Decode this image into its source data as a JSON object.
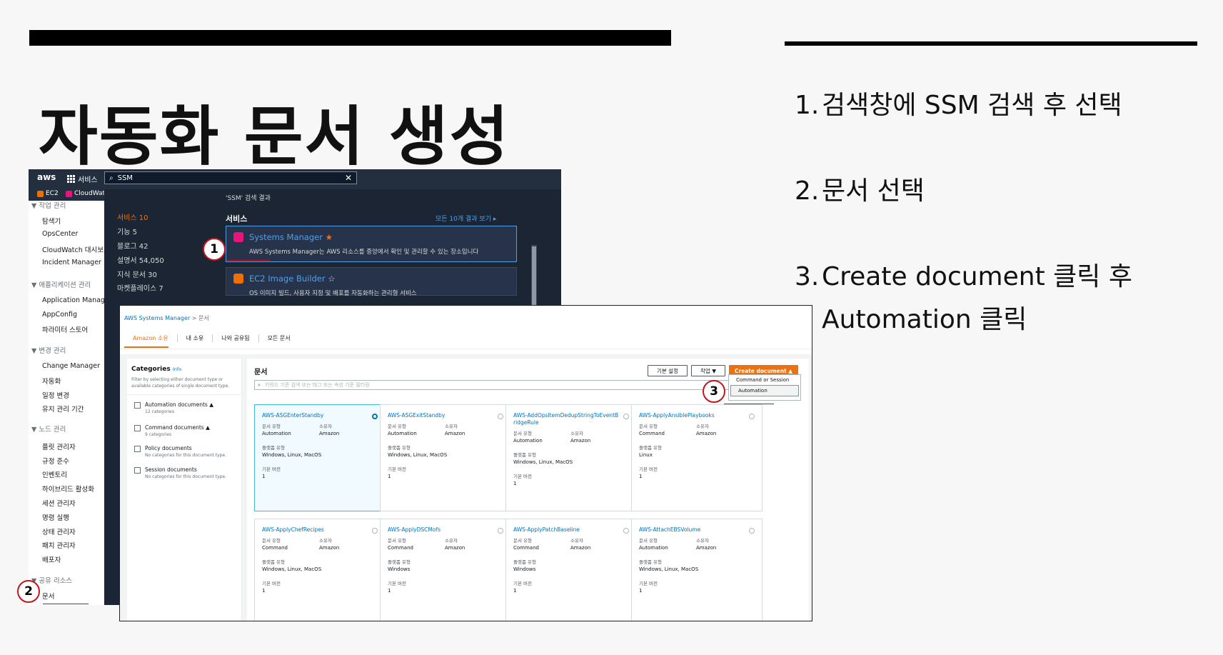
{
  "slide": {
    "title": "자동화 문서 생성",
    "steps": [
      {
        "num": "1.",
        "text": "검색창에 SSM 검색 후 선택"
      },
      {
        "num": "2.",
        "text": "문서 선택"
      },
      {
        "num": "3.",
        "text": "Create document 클릭 후 Automation 클릭"
      }
    ],
    "markers": [
      "1",
      "2",
      "3"
    ]
  },
  "console": {
    "logo": "aws",
    "services_label": "서비스",
    "search_value": "SSM",
    "favorites": [
      "EC2",
      "CloudWatch"
    ],
    "sidenav": {
      "sections": [
        {
          "title": "작업 관리",
          "items": [
            "탐색기",
            "OpsCenter",
            "CloudWatch 대시보드",
            "Incident Manager"
          ]
        },
        {
          "title": "애플리케이션 관리",
          "items": [
            "Application Manager",
            "AppConfig",
            "파라미터 스토어"
          ]
        },
        {
          "title": "변경 관리",
          "items": [
            "Change Manager",
            "자동화",
            "일정 변경",
            "유지 관리 기간"
          ]
        },
        {
          "title": "노드 관리",
          "items": [
            "플릿 관리자",
            "규정 준수",
            "인벤토리",
            "하이브리드 활성화",
            "세션 관리자",
            "명령 실행",
            "상태 관리자",
            "패치 관리자",
            "배포자"
          ]
        },
        {
          "title": "공유 리소스",
          "items": [
            "문서"
          ]
        }
      ]
    },
    "search_dropdown": {
      "categories": [
        "서비스 10",
        "기능 5",
        "블로그 42",
        "설명서 54,050",
        "지식 문서 30",
        "마켓플레이스 7"
      ],
      "results_title": "'SSM' 검색 결과",
      "section_title": "서비스",
      "see_all": "모든 10개 결과 보기",
      "results": [
        {
          "name": "Systems Manager",
          "desc": "AWS Systems Manager는 AWS 리소스를 중앙에서 확인 및 관리할 수 있는 장소입니다",
          "star": "★",
          "color": "#e7157b"
        },
        {
          "name": "EC2 Image Builder",
          "desc": "OS 이미지 빌드, 사용자 지정 및 배포를 자동화하는 관리형 서비스",
          "star": "☆",
          "color": "#ed7100"
        }
      ]
    }
  },
  "documents_page": {
    "breadcrumb": [
      "AWS Systems Manager",
      "문서"
    ],
    "tabs": [
      "Amazon 소유",
      "내 소유",
      "나와 공유됨",
      "모든 문서"
    ],
    "categories": {
      "title": "Categories",
      "info": "Info",
      "desc": "Filter by selecting either document type or available categories of single document type.",
      "items": [
        {
          "label": "Automation documents",
          "sub": "12 categories"
        },
        {
          "label": "Command documents",
          "sub": "9 categories"
        },
        {
          "label": "Policy documents",
          "sub": "No categories for this document type."
        },
        {
          "label": "Session documents",
          "sub": "No categories for this document type."
        }
      ]
    },
    "main_title": "문서",
    "buttons": {
      "default_settings": "기본 설정",
      "actions": "작업",
      "create": "Create document"
    },
    "create_menu": [
      "Command or Session",
      "Automation"
    ],
    "filter_placeholder": "키워드 기준 검색 또는 태그 또는 속성 기준 필터링",
    "field_labels": {
      "doc_type": "문서 유형",
      "owner": "소유자",
      "platform": "플랫폼 유형",
      "version": "기본 버전"
    },
    "cards": [
      {
        "name": "AWS-ASGEnterStandby",
        "type": "Automation",
        "owner": "Amazon",
        "platform": "Windows, Linux, MacOS",
        "version": "1",
        "selected": true
      },
      {
        "name": "AWS-ASGExitStandby",
        "type": "Automation",
        "owner": "Amazon",
        "platform": "Windows, Linux, MacOS",
        "version": "1",
        "selected": false
      },
      {
        "name": "AWS-AddOpsItemDedupStringToEventBridgeRule",
        "type": "Automation",
        "owner": "Amazon",
        "platform": "Windows, Linux, MacOS",
        "version": "1",
        "selected": false
      },
      {
        "name": "AWS-ApplyAnsiblePlaybooks",
        "type": "Command",
        "owner": "Amazon",
        "platform": "Linux",
        "version": "1",
        "selected": false
      },
      {
        "name": "AWS-ApplyChefRecipes",
        "type": "Command",
        "owner": "Amazon",
        "platform": "Windows, Linux, MacOS",
        "version": "1",
        "selected": false
      },
      {
        "name": "AWS-ApplyDSCMofs",
        "type": "Command",
        "owner": "Amazon",
        "platform": "Windows",
        "version": "1",
        "selected": false
      },
      {
        "name": "AWS-ApplyPatchBaseline",
        "type": "Command",
        "owner": "Amazon",
        "platform": "Windows",
        "version": "1",
        "selected": false
      },
      {
        "name": "AWS-AttachEBSVolume",
        "type": "Automation",
        "owner": "Amazon",
        "platform": "Windows, Linux, MacOS",
        "version": "1",
        "selected": false
      }
    ]
  }
}
